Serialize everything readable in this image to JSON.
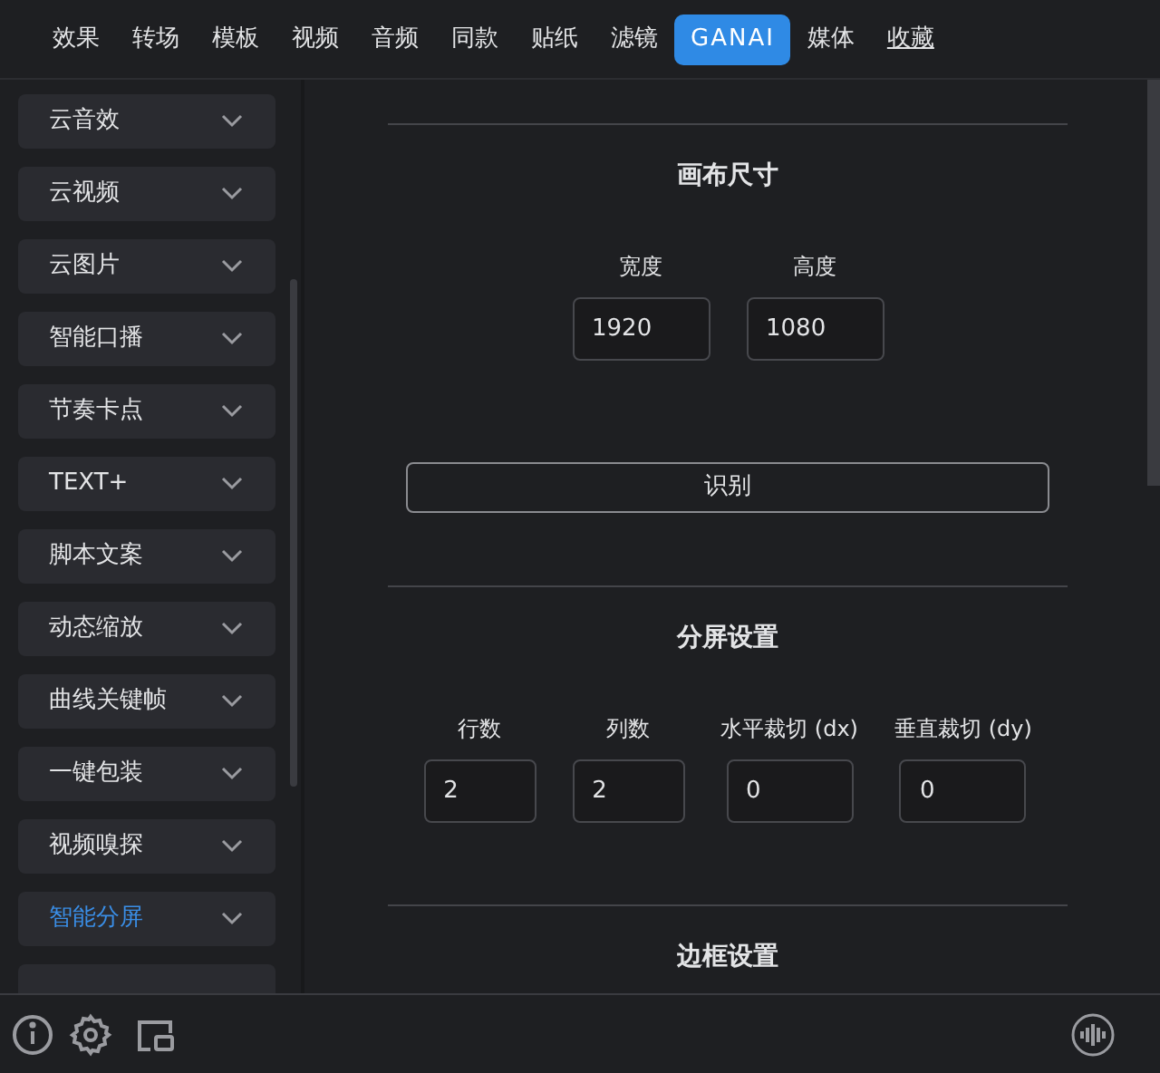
{
  "nav_tabs": [
    {
      "label": "效果",
      "selected": false,
      "underlined": false
    },
    {
      "label": "转场",
      "selected": false,
      "underlined": false
    },
    {
      "label": "模板",
      "selected": false,
      "underlined": false
    },
    {
      "label": "视频",
      "selected": false,
      "underlined": false
    },
    {
      "label": "音频",
      "selected": false,
      "underlined": false
    },
    {
      "label": "同款",
      "selected": false,
      "underlined": false
    },
    {
      "label": "贴纸",
      "selected": false,
      "underlined": false
    },
    {
      "label": "滤镜",
      "selected": false,
      "underlined": false
    },
    {
      "label": "GANAI",
      "selected": true,
      "underlined": false
    },
    {
      "label": "媒体",
      "selected": false,
      "underlined": false
    },
    {
      "label": "收藏",
      "selected": false,
      "underlined": true
    }
  ],
  "sidebar": {
    "items": [
      {
        "label": "云音效",
        "selected": false
      },
      {
        "label": "云视频",
        "selected": false
      },
      {
        "label": "云图片",
        "selected": false
      },
      {
        "label": "智能口播",
        "selected": false
      },
      {
        "label": "节奏卡点",
        "selected": false
      },
      {
        "label": "TEXT+",
        "selected": false
      },
      {
        "label": "脚本文案",
        "selected": false
      },
      {
        "label": "动态缩放",
        "selected": false
      },
      {
        "label": "曲线关键帧",
        "selected": false
      },
      {
        "label": "一键包装",
        "selected": false
      },
      {
        "label": "视频嗅探",
        "selected": false
      },
      {
        "label": "智能分屏",
        "selected": true
      }
    ]
  },
  "sections": [
    {
      "title": "画布尺寸",
      "fields": [
        {
          "label": "宽度",
          "value": "1920"
        },
        {
          "label": "高度",
          "value": "1080"
        }
      ],
      "button": "识别"
    },
    {
      "title": "分屏设置",
      "fields": [
        {
          "label": "行数",
          "value": "2"
        },
        {
          "label": "列数",
          "value": "2"
        },
        {
          "label": "水平裁切 (dx)",
          "value": "0"
        },
        {
          "label": "垂直裁切 (dy)",
          "value": "0"
        }
      ]
    },
    {
      "title": "边框设置"
    }
  ]
}
